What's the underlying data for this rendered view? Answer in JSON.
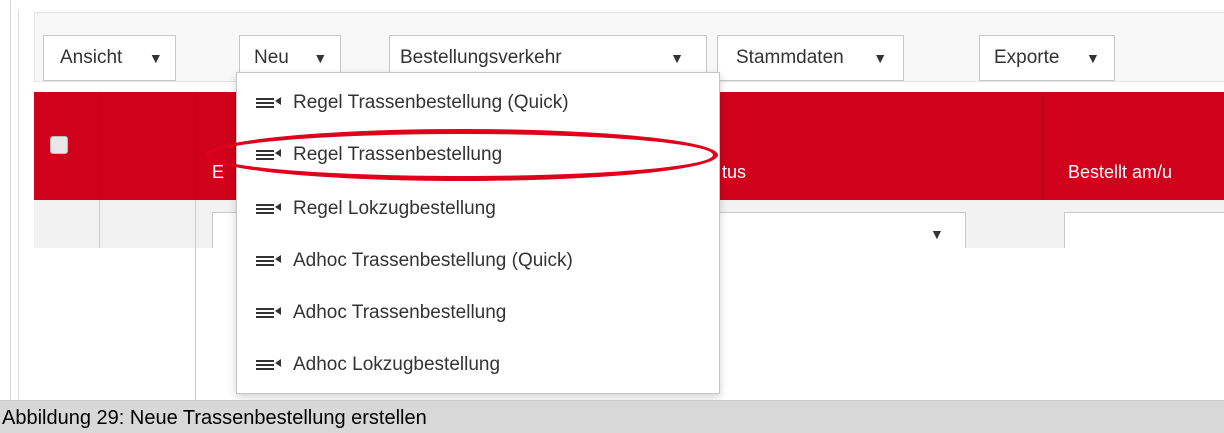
{
  "toolbar": {
    "ansicht_label": "Ansicht",
    "neu_label": "Neu",
    "bestellungsverkehr_label": "Bestellungsverkehr",
    "stammdaten_label": "Stammdaten",
    "exporte_label": "Exporte",
    "caret": "▼"
  },
  "table": {
    "col2_header": "E",
    "col3_header": "tus",
    "col4_header": "Bestellt am/u"
  },
  "menu": {
    "items": [
      "Regel Trassenbestellung (Quick)",
      "Regel Trassenbestellung",
      "Regel Lokzugbestellung",
      "Adhoc Trassenbestellung (Quick)",
      "Adhoc Trassenbestellung",
      "Adhoc Lokzugbestellung"
    ],
    "highlighted_item": "Regel Trassenbestellung"
  },
  "caption": "Abbildung 29: Neue Trassenbestellung erstellen",
  "colors": {
    "header_red": "#d0021b",
    "highlight_red": "#e0001b"
  }
}
